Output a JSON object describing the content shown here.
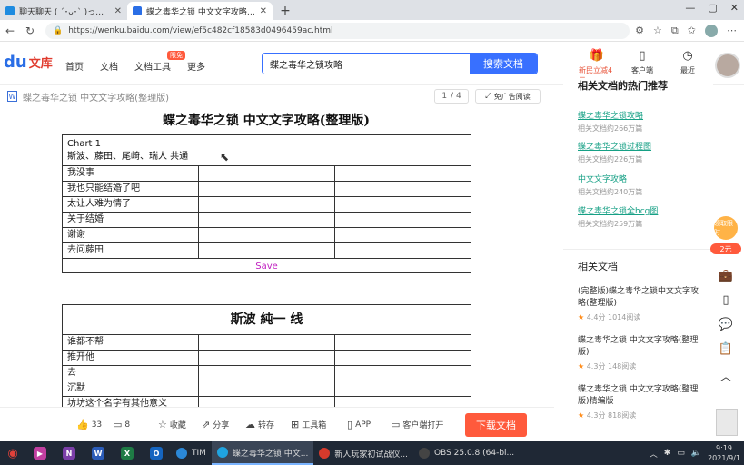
{
  "browser": {
    "tabs": [
      {
        "label": "聊天聊天 ( ´･ᴗ･` )っ□ 干杯~-bili…",
        "active": false
      },
      {
        "label": "蝶之毒华之锁 中文文字攻略(整理…",
        "active": true
      }
    ],
    "url": "https://wenku.baidu.com/view/ef5c482cf18583d0496459ac.html"
  },
  "site": {
    "logo_text": "文库",
    "nav": [
      "首页",
      "文档",
      "文档工具",
      "更多"
    ],
    "nav_badge": "限免",
    "search_value": "蝶之毒华之锁攻略",
    "search_button": "搜索文档",
    "header_items": [
      {
        "label": "新民立减4元",
        "icon": "gift-icon"
      },
      {
        "label": "客户端",
        "icon": "phone-icon"
      },
      {
        "label": "最近",
        "icon": "clock-icon"
      }
    ]
  },
  "docbar": {
    "title": "蝶之毒华之锁 中文文字攻略(整理版)",
    "page_current": "1",
    "page_total": "/ 4",
    "ad_free": "免广告阅读"
  },
  "document": {
    "heading": "蝶之毒华之锁 中文文字攻略(整理版)",
    "chart_label": "Chart  1",
    "chart_names": "斯波、藤田、尾崎、瑞人  共通",
    "box1_rows": [
      "我没事",
      "我也只能结婚了吧",
      "太让人难为情了",
      "关于结婚",
      "谢谢",
      "去问藤田"
    ],
    "save_label": "Save",
    "box2_title": "斯波 純一 线",
    "box2_rows": [
      "谁都不帮",
      "推开他",
      "去",
      "沉默",
      "坊坊这个名字有其他意义"
    ]
  },
  "doctools": {
    "like_count": "33",
    "comment_count": "8",
    "collect": "收藏",
    "share": "分享",
    "save": "转存",
    "toolbox": "工具箱",
    "app": "APP",
    "client_open": "客户端打开",
    "download": "下载文档"
  },
  "sidebar": {
    "card1_title": "相关文档的热门推荐",
    "related": [
      {
        "title": "蝶之毒华之锁攻略",
        "count": "相关文档约266万篇"
      },
      {
        "title": "蝶之毒华之锁过程图",
        "count": "相关文档约226万篇"
      },
      {
        "title": "中文文字攻略",
        "count": "相关文档约240万篇"
      },
      {
        "title": "蝶之毒华之锁全hcg图",
        "count": "相关文档约259万篇"
      }
    ],
    "card2_title": "相关文档",
    "docs": [
      {
        "title": "(完整版)蝶之毒华之锁中文文字攻略(整理版)",
        "rating": "4.4分",
        "views": "1014阅读"
      },
      {
        "title": "蝶之毒华之锁 中文文字攻略(整理版)",
        "rating": "4.3分",
        "views": "148阅读"
      },
      {
        "title": "蝶之毒华之锁 中文文字攻略(整理版)精编版",
        "rating": "4.3分",
        "views": "818阅读"
      }
    ],
    "promo_top": "领取限时",
    "promo_amount": "2元"
  },
  "taskbar": {
    "apps": [
      {
        "label": "TIM",
        "color": "#2b88d8",
        "active": false
      },
      {
        "label": "蝶之毒华之锁 中文...",
        "color": "#1fa3e0",
        "active": true
      },
      {
        "label": "新人玩家初试战仪...",
        "color": "#d73a2c",
        "active": false
      },
      {
        "label": "OBS 25.0.8 (64-bi...",
        "color": "#444444",
        "active": false
      }
    ],
    "time": "9:19",
    "date": "2021/9/1"
  }
}
